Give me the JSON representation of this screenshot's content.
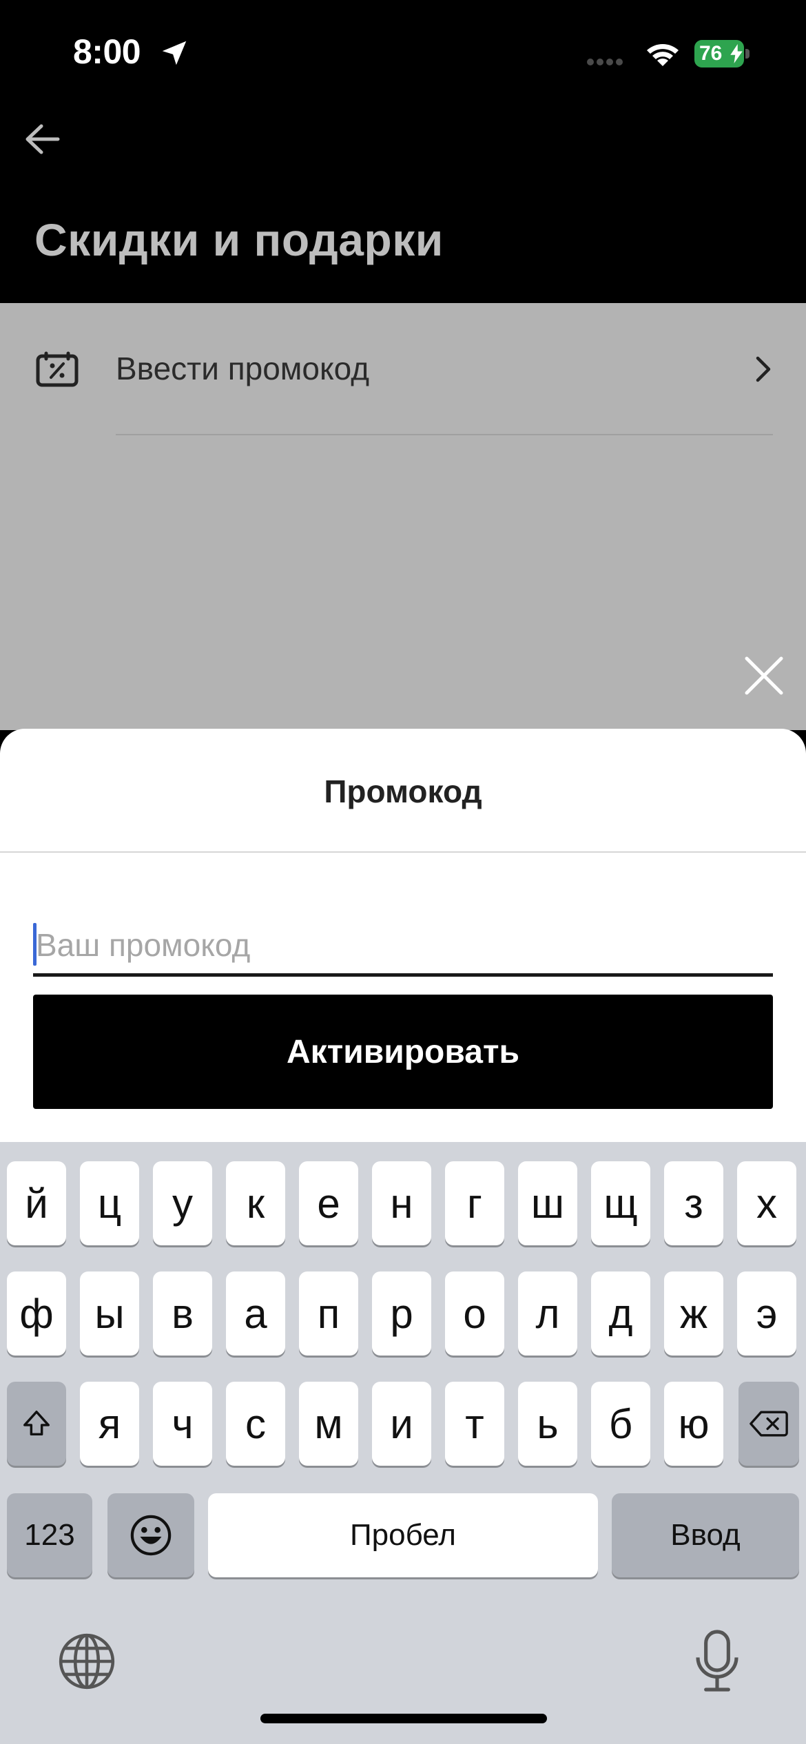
{
  "status_bar": {
    "time": "8:00",
    "battery": "76"
  },
  "header": {
    "title": "Скидки и подарки"
  },
  "list": {
    "items": [
      {
        "label": "Ввести промокод"
      }
    ]
  },
  "sheet": {
    "title": "Промокод",
    "input_placeholder": "Ваш промокод",
    "input_value": "",
    "activate_label": "Активировать"
  },
  "keyboard": {
    "row1": [
      "й",
      "ц",
      "у",
      "к",
      "е",
      "н",
      "г",
      "ш",
      "щ",
      "з",
      "х"
    ],
    "row2": [
      "ф",
      "ы",
      "в",
      "а",
      "п",
      "р",
      "о",
      "л",
      "д",
      "ж",
      "э"
    ],
    "row3": [
      "я",
      "ч",
      "с",
      "м",
      "и",
      "т",
      "ь",
      "б",
      "ю"
    ],
    "numbers_label": "123",
    "space_label": "Пробел",
    "return_label": "Ввод"
  },
  "colors": {
    "battery": "#2ea44f",
    "cursor": "#3a68d6",
    "overlay": "#b3b3b3",
    "keyboard_bg": "#d1d4da"
  }
}
